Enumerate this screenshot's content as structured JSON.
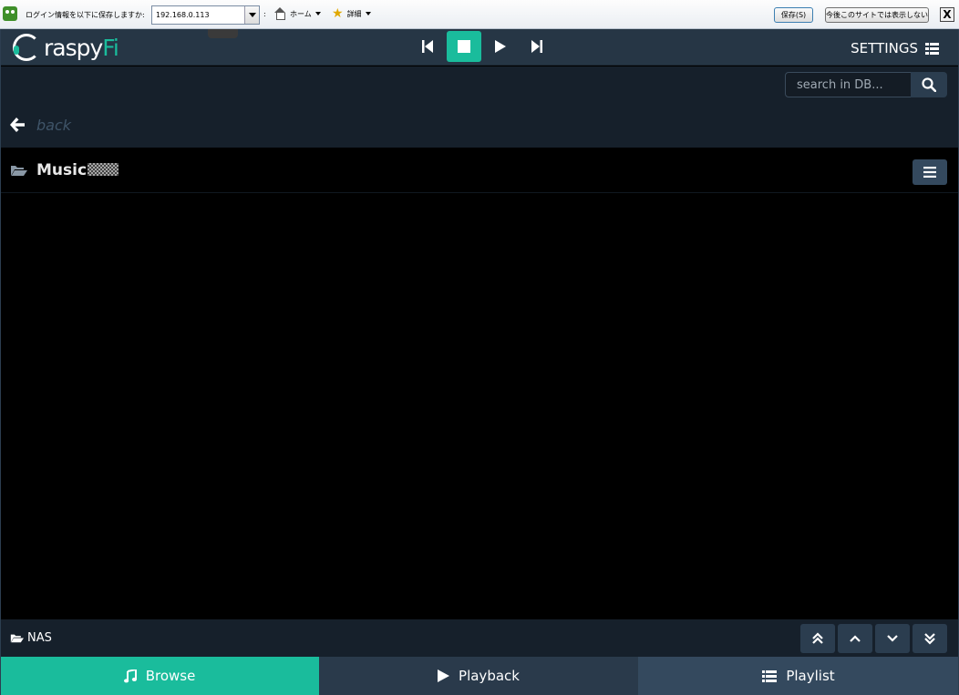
{
  "browser_bar": {
    "prompt": "ログイン情報を以下に保存しますか:",
    "account_value": "192.168.0.113",
    "colon": ":",
    "home_label": "ホーム",
    "detail_label": "詳細",
    "save_label": "保存(S)",
    "never_label": "今後このサイトでは表示しない",
    "close_label": "X"
  },
  "navbar": {
    "logo_main": "rasp",
    "logo_y": "y",
    "logo_accent": "Fi",
    "settings_label": "SETTINGS"
  },
  "search": {
    "placeholder": "search in DB..."
  },
  "back": {
    "label": "back"
  },
  "path": {
    "label": "Music"
  },
  "bottom_bar": {
    "source_label": "NAS"
  },
  "footer": {
    "tabs": [
      {
        "label": "Browse"
      },
      {
        "label": "Playback"
      },
      {
        "label": "Playlist"
      }
    ]
  },
  "colors": {
    "accent": "#1abc9c",
    "navbar": "#263645",
    "panel": "#16202b"
  }
}
